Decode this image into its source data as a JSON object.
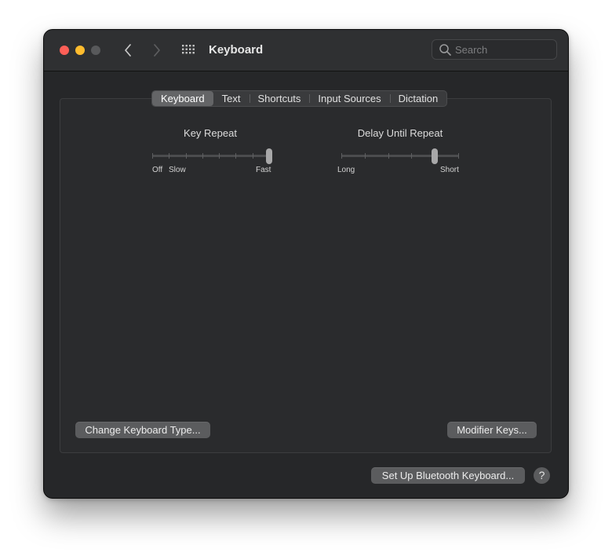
{
  "window": {
    "title": "Keyboard",
    "traffic_lights": {
      "close": "#fe5f57",
      "minimize": "#febc2e",
      "zoom": "#58595b"
    },
    "nav": {
      "back_icon": "chevron-left-icon",
      "forward_icon": "chevron-right-icon",
      "grid_icon": "show-all-grid-icon"
    }
  },
  "search": {
    "placeholder": "Search",
    "value": "",
    "icon": "magnifying-glass-icon"
  },
  "tabs": [
    {
      "label": "Keyboard",
      "selected": true
    },
    {
      "label": "Text",
      "selected": false
    },
    {
      "label": "Shortcuts",
      "selected": false
    },
    {
      "label": "Input Sources",
      "selected": false
    },
    {
      "label": "Dictation",
      "selected": false
    }
  ],
  "key_repeat": {
    "title": "Key Repeat",
    "labels": {
      "off": "Off",
      "slow": "Slow",
      "fast": "Fast"
    },
    "tick_count": 8,
    "level": 1.0
  },
  "delay_until_repeat": {
    "title": "Delay Until Repeat",
    "labels": {
      "long": "Long",
      "short": "Short"
    },
    "tick_count": 6,
    "level": 0.8
  },
  "buttons": {
    "change_keyboard_type": "Change Keyboard Type...",
    "modifier_keys": "Modifier Keys...",
    "bluetooth": "Set Up Bluetooth Keyboard...",
    "help": "?"
  },
  "colors": {
    "window_bg": "#262729",
    "titlebar_bg": "#2f3032",
    "button_bg": "#5b5c5e",
    "tab_selected_bg": "#646567",
    "slider_knob": "#a8a8a9"
  }
}
